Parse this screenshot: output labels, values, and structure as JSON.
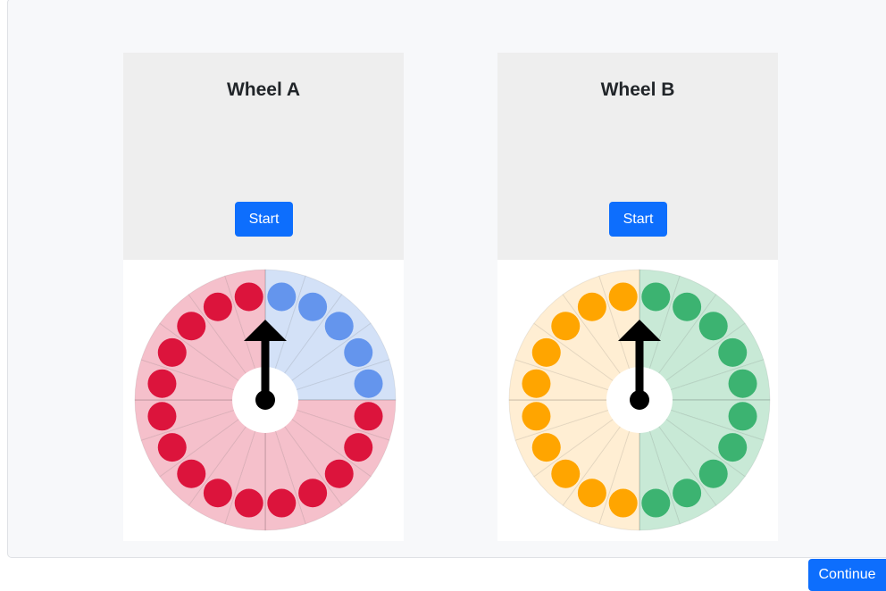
{
  "wheels": [
    {
      "title": "Wheel A",
      "start_label": "Start",
      "segments": 20,
      "colors": {
        "a": "#dc143c",
        "a_bg": "#f5c0cb",
        "b": "#6495ed",
        "b_bg": "#d3e1f7"
      },
      "color_b_count": 5,
      "color_a_count": 15,
      "pointer_segment": 0
    },
    {
      "title": "Wheel B",
      "start_label": "Start",
      "segments": 20,
      "colors": {
        "a": "#ffa500",
        "a_bg": "#ffeed3",
        "b": "#3cb371",
        "b_bg": "#c8e9d6"
      },
      "color_b_count": 10,
      "color_a_count": 10,
      "pointer_segment": 0
    }
  ],
  "continue_label": "Continue"
}
